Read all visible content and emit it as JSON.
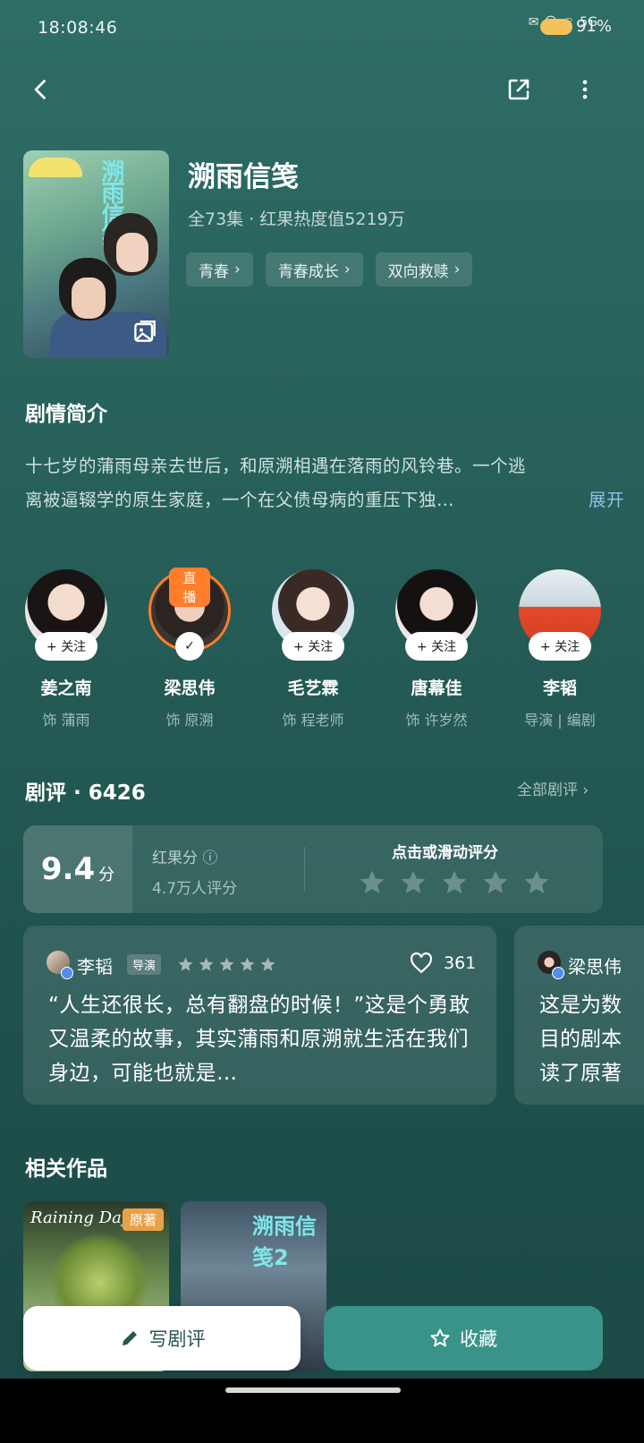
{
  "status": {
    "time": "18:08:46",
    "network": "5G",
    "battery": "91%"
  },
  "show": {
    "title": "溯雨信笺",
    "meta": "全73集 · 红果热度值5219万",
    "tags": [
      "青春",
      "青春成长",
      "双向救赎"
    ]
  },
  "synopsis": {
    "title": "剧情简介",
    "line1": "十七岁的蒲雨母亲去世后，和原溯相遇在落雨的风铃巷。一个逃",
    "line2": "离被逼辍学的原生家庭，一个在父债母病的重压下独…",
    "expand": "展开"
  },
  "cast": [
    {
      "name": "姜之南",
      "role": "饰 蒲雨",
      "follow": "+ 关注",
      "live": ""
    },
    {
      "name": "梁思伟",
      "role": "饰 原溯",
      "follow": "✓",
      "live": "直播"
    },
    {
      "name": "毛艺霖",
      "role": "饰 程老师",
      "follow": "+ 关注",
      "live": ""
    },
    {
      "name": "唐幕佳",
      "role": "饰 许岁然",
      "follow": "+ 关注",
      "live": ""
    },
    {
      "name": "李韬",
      "role": "导演 | 编剧",
      "follow": "+ 关注",
      "live": ""
    }
  ],
  "reviews": {
    "title": "剧评 · 6426",
    "all_link": "全部剧评 ›",
    "score": "9.4",
    "score_unit": "分",
    "score_label": "红果分 ⓘ",
    "score_count": "4.7万人评分",
    "rate_prompt": "点击或滑动评分",
    "cards": [
      {
        "author": "李韬",
        "badge": "导演",
        "likes": "361",
        "text": "“人生还很长，总有翻盘的时候！”这是个勇敢又温柔的故事，其实蒲雨和原溯就生活在我们身边，可能也就是…"
      },
      {
        "author": "梁思伟",
        "text": "这是为数 目的剧本 读了原著"
      }
    ]
  },
  "related": {
    "title": "相关作品",
    "items": [
      {
        "badge": "原著",
        "script": "Raining Day"
      },
      {
        "badge": "",
        "script": "溯雨信笺2"
      }
    ]
  },
  "actions": {
    "write": "写剧评",
    "collect": "收藏"
  },
  "colors": {
    "accent": "#3a938a",
    "live": "#ff7d2b",
    "link": "#8fc1f0"
  }
}
